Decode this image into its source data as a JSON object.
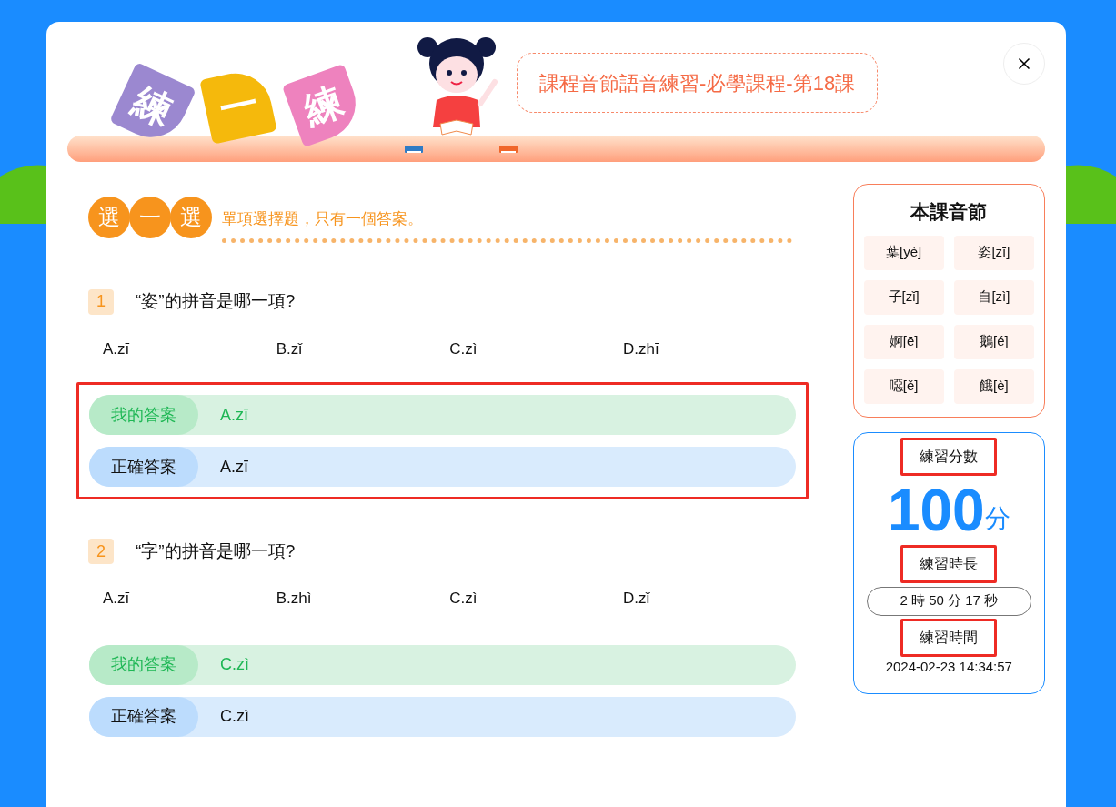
{
  "header": {
    "tiles": [
      {
        "char": "練",
        "color": "#9b88d0"
      },
      {
        "char": "一",
        "color": "#f5b90c"
      },
      {
        "char": "練",
        "color": "#ee82be"
      }
    ],
    "title": "課程音節語音練習-必學課程-第18課"
  },
  "section": {
    "badge": [
      "選",
      "一",
      "選"
    ],
    "subtitle": "單項選擇題，只有一個答案。"
  },
  "questions": [
    {
      "number": "1",
      "text": "“姿”的拼音是哪一項?",
      "options": [
        "A.zī",
        "B.zǐ",
        "C.zì",
        "D.zhī"
      ],
      "my_answer": {
        "label": "我的答案",
        "value": "A.zī"
      },
      "correct_answer": {
        "label": "正確答案",
        "value": "A.zī"
      },
      "highlighted": true
    },
    {
      "number": "2",
      "text": "“字”的拼音是哪一項?",
      "options": [
        "A.zī",
        "B.zhì",
        "C.zì",
        "D.zǐ"
      ],
      "my_answer": {
        "label": "我的答案",
        "value": "C.zì"
      },
      "correct_answer": {
        "label": "正確答案",
        "value": "C.zì"
      },
      "highlighted": false
    }
  ],
  "syllables": {
    "title": "本課音節",
    "items": [
      "葉[yè]",
      "姿[zī]",
      "子[zǐ]",
      "自[zì]",
      "婀[ē]",
      "鵝[é]",
      "噁[ě]",
      "餓[è]"
    ]
  },
  "stats": {
    "score_label": {
      "text": "練習分數",
      "highlighted": true
    },
    "score": "100",
    "unit": "分",
    "duration_label": {
      "text": "練習時長",
      "highlighted": true
    },
    "duration": "2 時 50 分 17 秒",
    "time_label": {
      "text": "練習時間",
      "highlighted": true
    },
    "time": "2024-02-23 14:34:57"
  }
}
